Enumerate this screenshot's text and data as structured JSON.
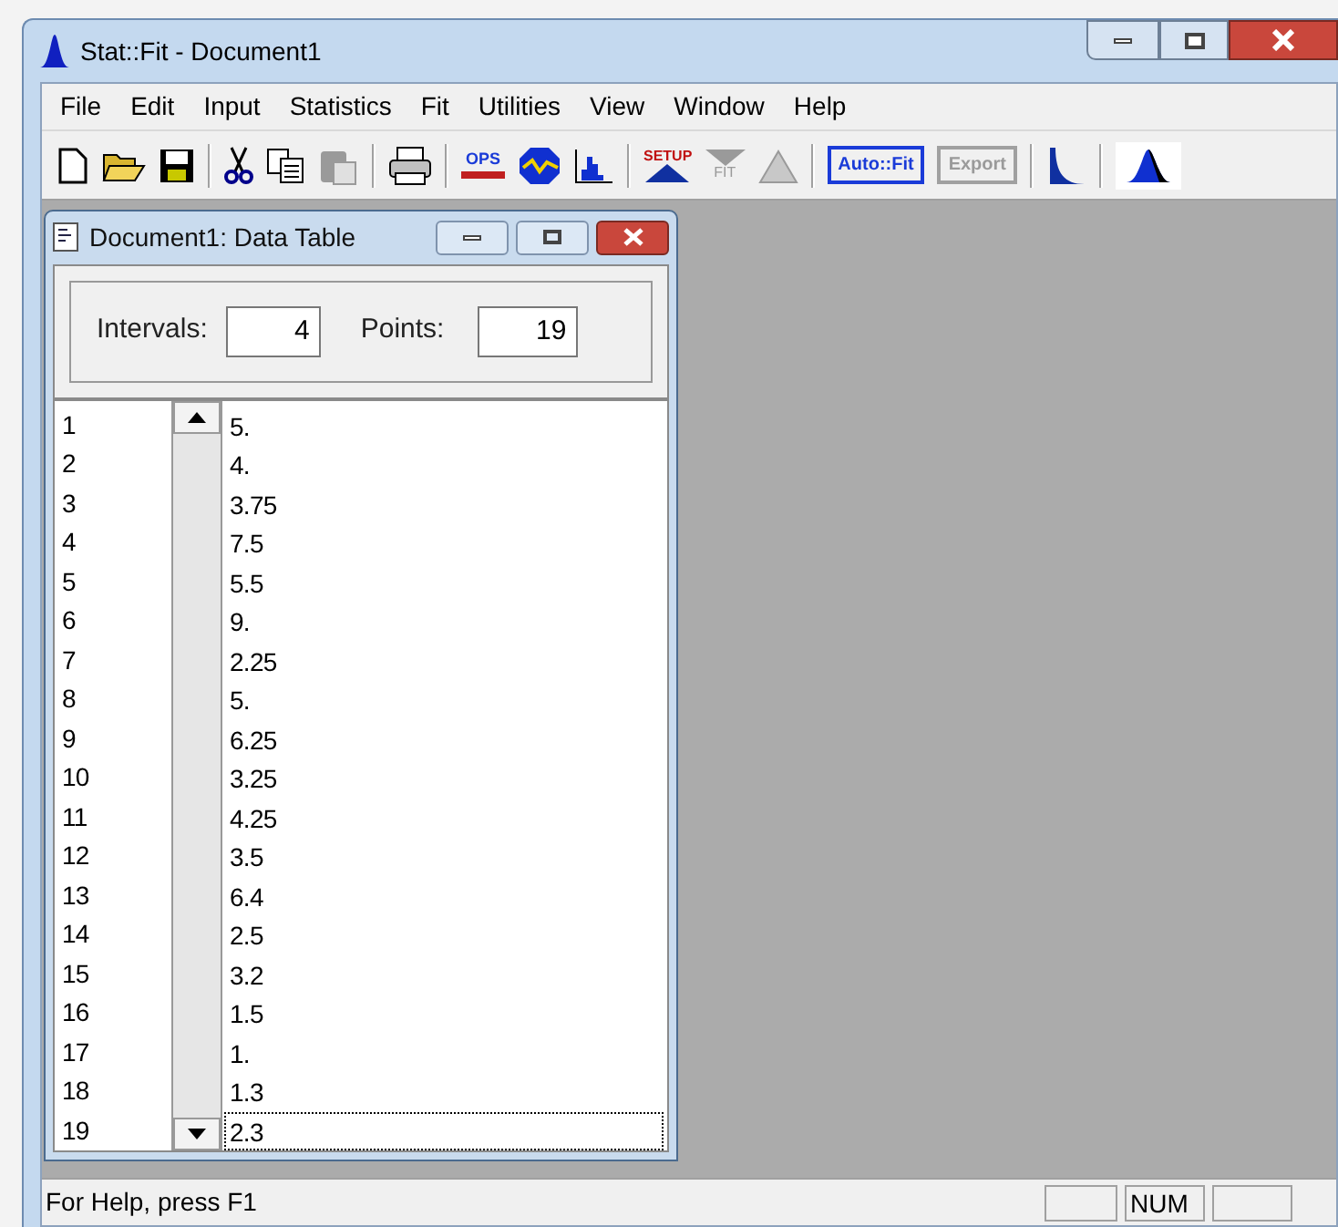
{
  "window": {
    "title": "Stat::Fit - Document1"
  },
  "menu": [
    "File",
    "Edit",
    "Input",
    "Statistics",
    "Fit",
    "Utilities",
    "View",
    "Window",
    "Help"
  ],
  "toolbar": [
    {
      "kind": "new",
      "disabled": false
    },
    {
      "kind": "open",
      "disabled": false
    },
    {
      "kind": "save",
      "disabled": false
    },
    {
      "kind": "separator"
    },
    {
      "kind": "cut",
      "disabled": false
    },
    {
      "kind": "copy",
      "disabled": false
    },
    {
      "kind": "paste",
      "disabled": true
    },
    {
      "kind": "separator"
    },
    {
      "kind": "print",
      "disabled": false
    },
    {
      "kind": "separator"
    },
    {
      "kind": "ops",
      "label": "OPS",
      "disabled": false
    },
    {
      "kind": "stats",
      "disabled": false
    },
    {
      "kind": "histogram",
      "disabled": false
    },
    {
      "kind": "separator"
    },
    {
      "kind": "setup",
      "label": "SETUP",
      "disabled": false
    },
    {
      "kind": "fit",
      "label": "FIT",
      "disabled": true
    },
    {
      "kind": "graph",
      "disabled": true
    },
    {
      "kind": "separator"
    },
    {
      "kind": "textbutton",
      "label": "Auto::Fit",
      "disabled": false
    },
    {
      "kind": "textbutton",
      "label": "Export",
      "disabled": true
    },
    {
      "kind": "separator"
    },
    {
      "kind": "decay",
      "disabled": false
    },
    {
      "kind": "separator"
    },
    {
      "kind": "peak",
      "disabled": false
    }
  ],
  "child_window": {
    "title": "Document1: Data Table",
    "intervals_label": "Intervals:",
    "intervals": "4",
    "points_label": "Points:",
    "points": "19",
    "rows": [
      {
        "index": "1",
        "value": "5.",
        "selected": false
      },
      {
        "index": "2",
        "value": "4.",
        "selected": false
      },
      {
        "index": "3",
        "value": "3.75",
        "selected": false
      },
      {
        "index": "4",
        "value": "7.5",
        "selected": false
      },
      {
        "index": "5",
        "value": "5.5",
        "selected": false
      },
      {
        "index": "6",
        "value": "9.",
        "selected": false
      },
      {
        "index": "7",
        "value": "2.25",
        "selected": false
      },
      {
        "index": "8",
        "value": "5.",
        "selected": false
      },
      {
        "index": "9",
        "value": "6.25",
        "selected": false
      },
      {
        "index": "10",
        "value": "3.25",
        "selected": false
      },
      {
        "index": "11",
        "value": "4.25",
        "selected": false
      },
      {
        "index": "12",
        "value": "3.5",
        "selected": false
      },
      {
        "index": "13",
        "value": "6.4",
        "selected": false
      },
      {
        "index": "14",
        "value": "2.5",
        "selected": false
      },
      {
        "index": "15",
        "value": "3.2",
        "selected": false
      },
      {
        "index": "16",
        "value": "1.5",
        "selected": false
      },
      {
        "index": "17",
        "value": "1.",
        "selected": false
      },
      {
        "index": "18",
        "value": "1.3",
        "selected": false
      },
      {
        "index": "19",
        "value": "2.3",
        "selected": true
      }
    ]
  },
  "status_bar": {
    "message": "For Help, press F1",
    "num": "NUM"
  }
}
